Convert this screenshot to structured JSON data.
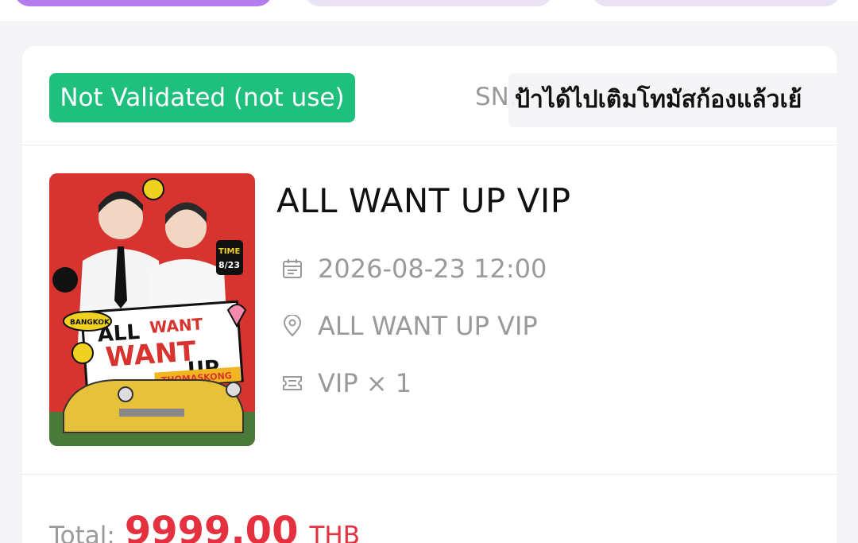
{
  "ticket": {
    "status": "Not Validated (not use)",
    "sn_label": "SN.",
    "overlay_text": "ป้าได้ไปเติมโทมัสก้องแล้วเย้",
    "event_title": "ALL WANT UP VIP",
    "date": "2026-08-23 12:00",
    "venue": "ALL WANT UP VIP",
    "ticket_type": "VIP × 1"
  },
  "poster": {
    "tag_city": "BANGKOK",
    "title_line1a": "ALL",
    "title_line1b": "WANT",
    "title_line2": "WANT",
    "title_line3": "UP",
    "artist": "THOMASKONG",
    "time_label": "TIME",
    "time_date": "8/23"
  },
  "total": {
    "label": "Total:",
    "amount": "9999.00",
    "currency": "THB"
  },
  "colors": {
    "status_green": "#1fbf7d",
    "price_red": "#e5303f",
    "tab_active": "#b57cf0",
    "poster_red": "#d8342f"
  },
  "icons": [
    "calendar-icon",
    "location-pin-icon",
    "ticket-icon"
  ]
}
